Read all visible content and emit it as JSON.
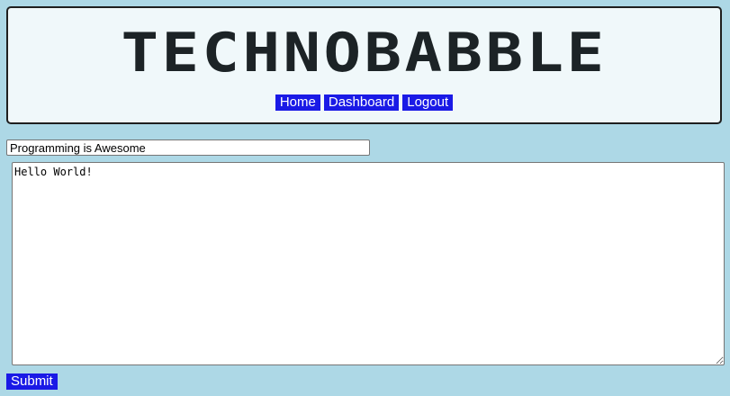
{
  "header": {
    "site_title": "TECHNOBABBLE",
    "nav": {
      "home_label": "Home",
      "dashboard_label": "Dashboard",
      "logout_label": "Logout"
    }
  },
  "form": {
    "title_value": "Programming is Awesome",
    "body_value": "Hello World!",
    "submit_label": "Submit"
  },
  "colors": {
    "page_background": "#add8e6",
    "header_background": "#f0f8fa",
    "button_background": "#1a1ae6",
    "title_text": "#1c2326"
  }
}
